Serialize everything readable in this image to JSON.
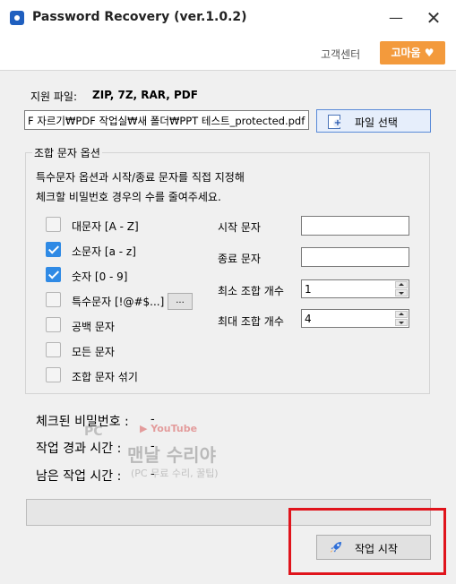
{
  "window": {
    "title": "Password Recovery (ver.1.0.2)",
    "minimize_glyph": "—",
    "close_glyph": "✕"
  },
  "topbar": {
    "support_label": "고객센터",
    "thanks_label": "고마움 ♥"
  },
  "file": {
    "supported_label": "지원 파일:",
    "supported_formats": "ZIP, 7Z, RAR, PDF",
    "path_value": "F 자르기₩PDF 작업실₩새 폴더₩PPT 테스트_protected.pdf",
    "select_button_label": "파일 선택"
  },
  "options": {
    "group_title": "조합 문자 옵션",
    "description_line1": "특수문자 옵션과 시작/종료 문자를 직접 지정해",
    "description_line2": "체크할 비밀번호 경우의 수를 줄여주세요.",
    "checkboxes": [
      {
        "label": "대문자 [A - Z]",
        "checked": false
      },
      {
        "label": "소문자 [a - z]",
        "checked": true
      },
      {
        "label": "숫자 [0 - 9]",
        "checked": true
      },
      {
        "label": "특수문자 [!@#$...]",
        "checked": false
      },
      {
        "label": "공백 문자",
        "checked": false
      },
      {
        "label": "모든 문자",
        "checked": false
      },
      {
        "label": "조합 문자 섞기",
        "checked": false
      }
    ],
    "more_button_label": "...",
    "start_char_label": "시작 문자",
    "start_char_value": "",
    "end_char_label": "종료 문자",
    "end_char_value": "",
    "min_len_label": "최소 조합 개수",
    "min_len_value": "1",
    "max_len_label": "최대 조합 개수",
    "max_len_value": "4"
  },
  "stats": {
    "checked_label": "체크된 비밀번호 :",
    "checked_value": "-",
    "elapsed_label": "작업 경과 시간 :",
    "elapsed_value": "-",
    "remaining_label": "남은 작업 시간 :",
    "remaining_value": "-"
  },
  "watermark": {
    "pc": "PC",
    "youtube": "▶ YouTube",
    "main": "맨날 수리야",
    "sub": "(PC 무료 수리, 꿀팁)"
  },
  "progress": {
    "fraction": 0
  },
  "actions": {
    "start_button_label": "작업 시작"
  },
  "colors": {
    "accent": "#2f8ae5",
    "thanks_button": "#f39a3c",
    "highlight_border": "#e0141c"
  }
}
